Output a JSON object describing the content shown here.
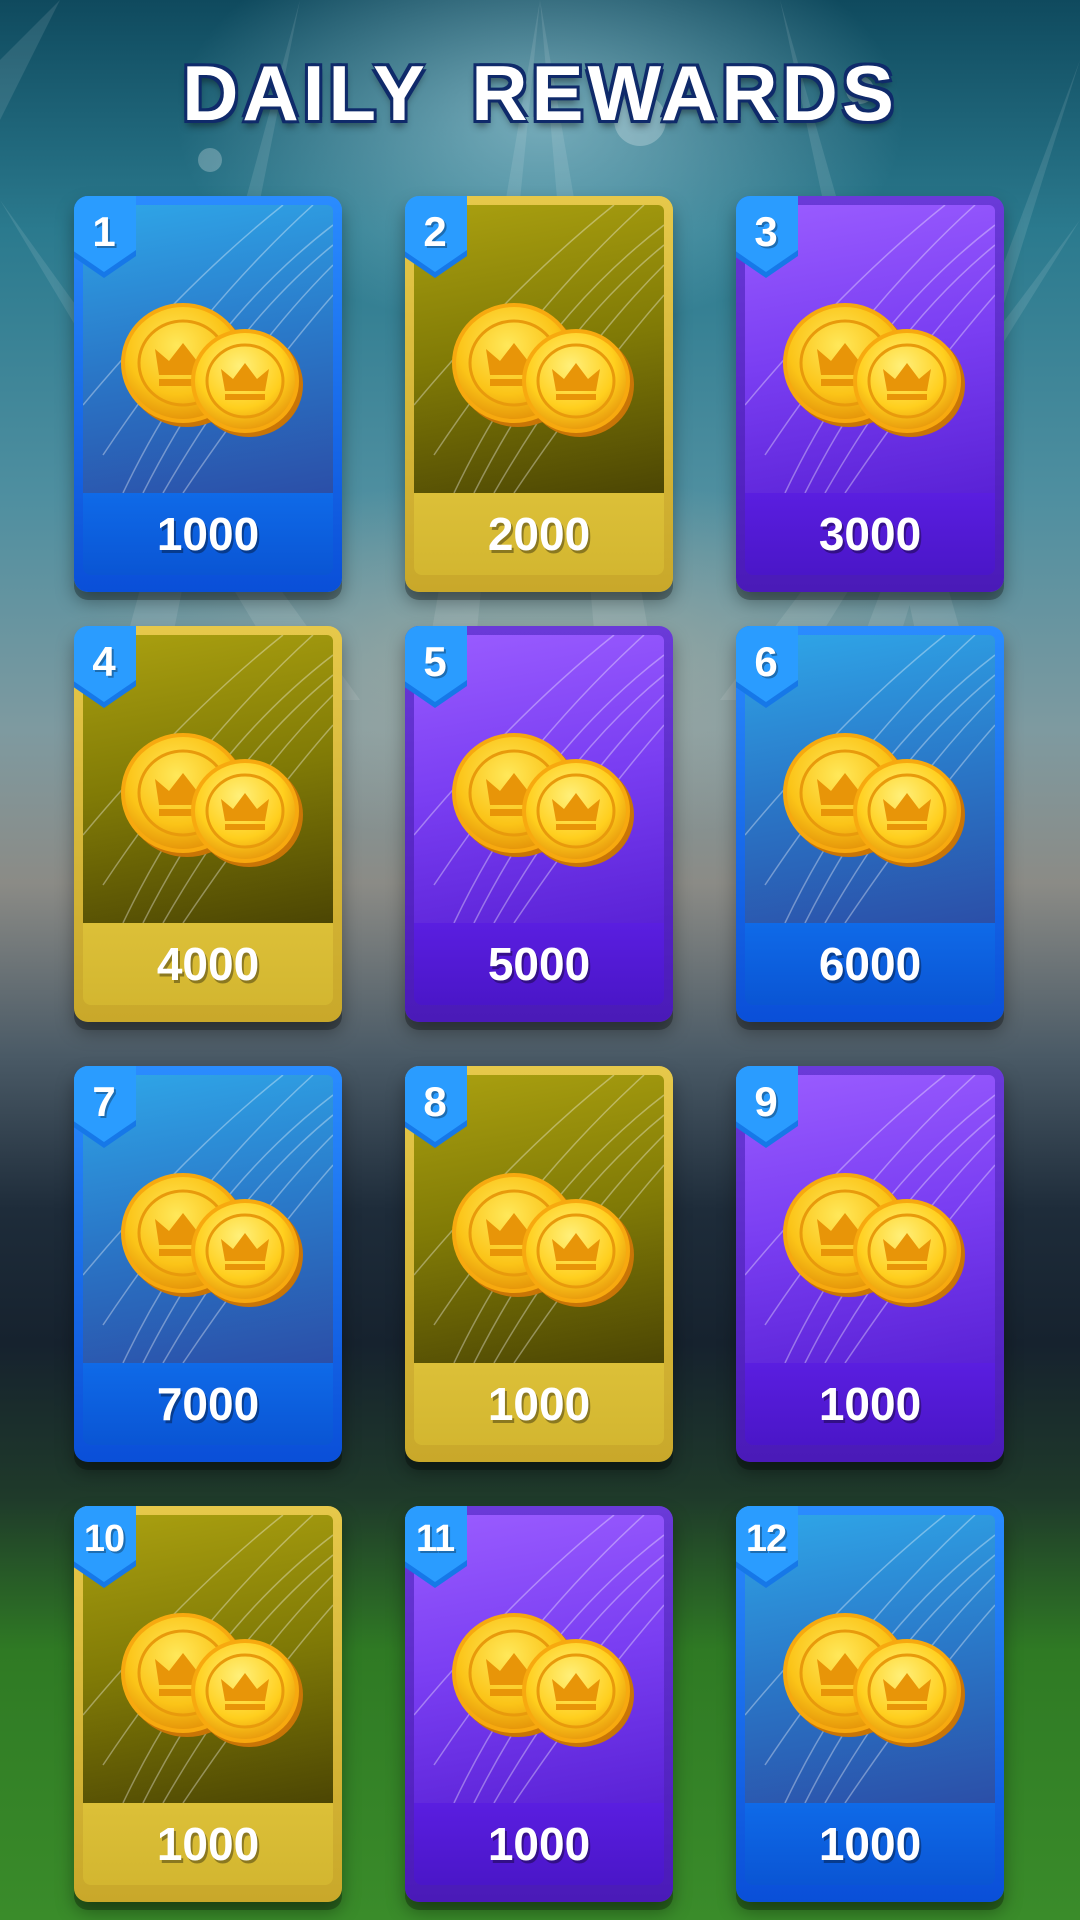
{
  "title": "DAILY  REWARDS",
  "icons": {
    "coin": "crown-coin-icon",
    "badge": "day-badge-shield"
  },
  "colors": {
    "blue": "#0a55d4",
    "gold": "#d3b630",
    "purple": "#4a16c8",
    "badge": "#1a8cff"
  },
  "rewards": [
    {
      "day": "1",
      "amount": "1000",
      "theme": "blue"
    },
    {
      "day": "2",
      "amount": "2000",
      "theme": "gold"
    },
    {
      "day": "3",
      "amount": "3000",
      "theme": "purple"
    },
    {
      "day": "4",
      "amount": "4000",
      "theme": "gold"
    },
    {
      "day": "5",
      "amount": "5000",
      "theme": "purple"
    },
    {
      "day": "6",
      "amount": "6000",
      "theme": "blue"
    },
    {
      "day": "7",
      "amount": "7000",
      "theme": "blue"
    },
    {
      "day": "8",
      "amount": "1000",
      "theme": "gold"
    },
    {
      "day": "9",
      "amount": "1000",
      "theme": "purple"
    },
    {
      "day": "10",
      "amount": "1000",
      "theme": "gold"
    },
    {
      "day": "11",
      "amount": "1000",
      "theme": "purple"
    },
    {
      "day": "12",
      "amount": "1000",
      "theme": "blue"
    }
  ]
}
